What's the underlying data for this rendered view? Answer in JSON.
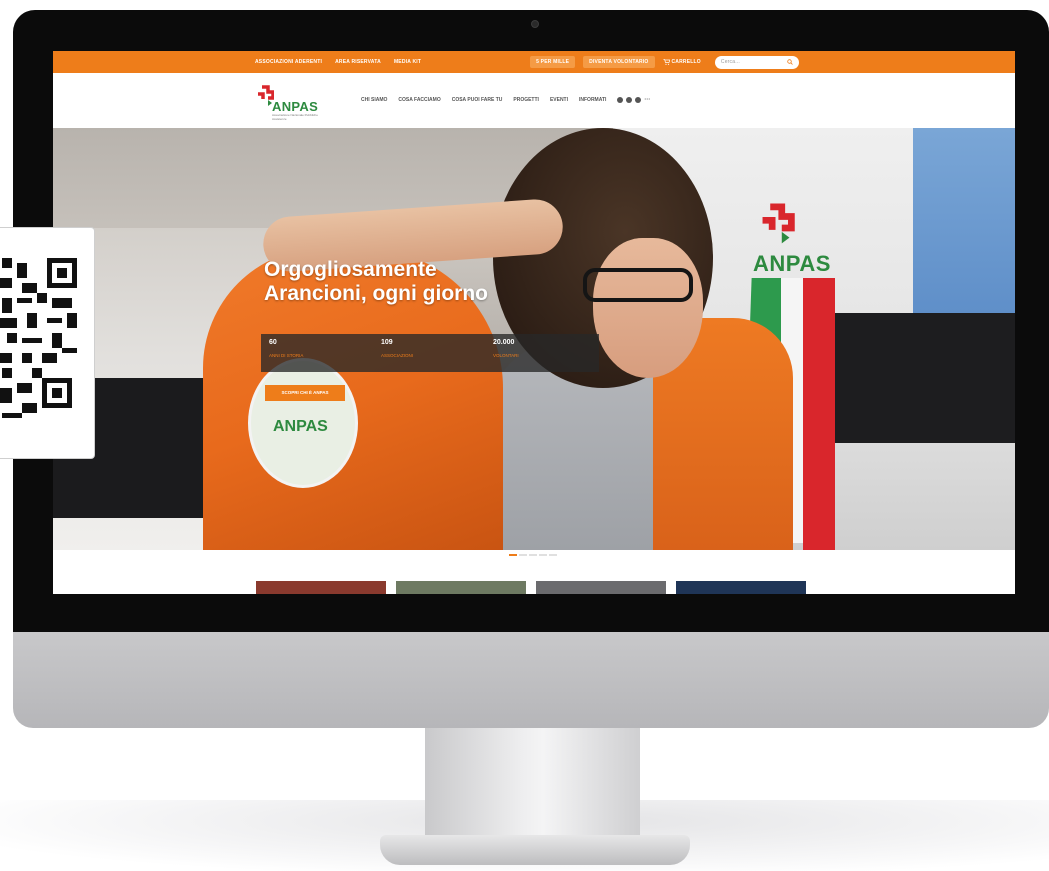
{
  "window": {
    "title": "ANPAS"
  },
  "topbar": {
    "links": [
      "Associazioni aderenti",
      "Area riservata",
      "Media kit"
    ],
    "pill_1": "5 per mille",
    "pill_2": "Diventa volontario",
    "cart_label": "Carrello",
    "search_placeholder": "Cerca..."
  },
  "navbar": {
    "logo_text": "ANPAS",
    "logo_subtext": "Associazione Nazionale Pubbliche Assistenze",
    "menu": [
      "Chi siamo",
      "Cosa facciamo",
      "Cosa puoi fare tu",
      "Progetti",
      "Eventi",
      "Informati"
    ],
    "social_icons": [
      "facebook-icon",
      "instagram-icon",
      "youtube-icon",
      "more-icon"
    ]
  },
  "hero": {
    "title_line1": "Orgogliosamente",
    "title_line2": "Arancioni, ogni giorno",
    "van_logo": "ANPAS",
    "vest_logo": "ANPAS",
    "stats": [
      {
        "num": "60",
        "label": "Anni di storia"
      },
      {
        "num": "109",
        "label": "Associazioni"
      },
      {
        "num": "20.000",
        "label": "Volontari"
      }
    ],
    "cta_label": "Scopri chi è Anpas",
    "slides": 5,
    "active_slide": 1
  },
  "cards": [
    {
      "color": "#8a3a2e"
    },
    {
      "color": "#6e7a62"
    },
    {
      "color": "#6b6b6e"
    },
    {
      "color": "#1f3557"
    }
  ],
  "colors": {
    "brand_orange": "#ee7d1a",
    "brand_green": "#2d8a3f",
    "brand_red": "#d9262c"
  }
}
